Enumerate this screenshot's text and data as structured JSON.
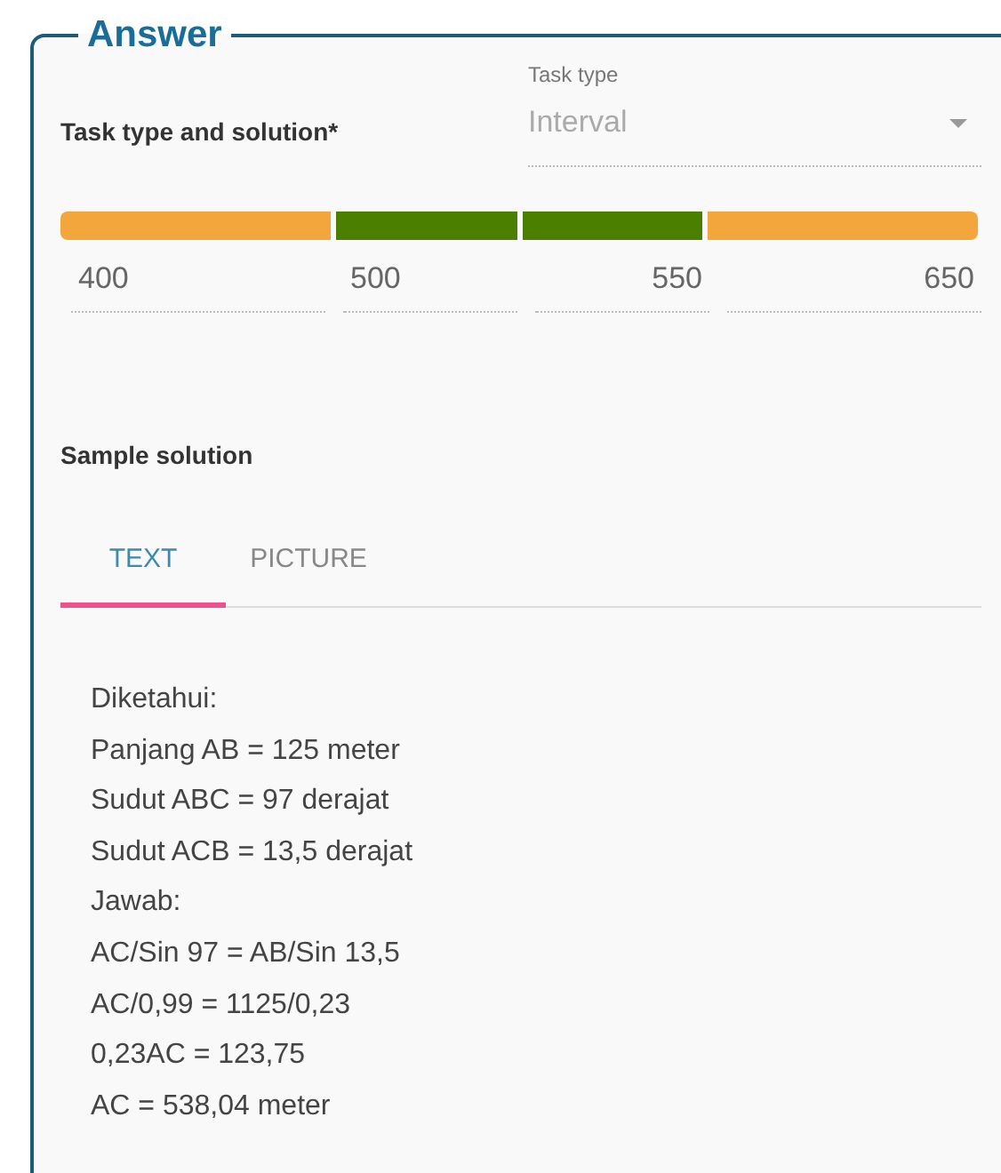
{
  "legend": "Answer",
  "task_row": {
    "label": "Task type and solution*",
    "select": {
      "label": "Task type",
      "value": "Interval",
      "disabled": true
    }
  },
  "interval": {
    "segments": [
      {
        "color": "#f2a63b"
      },
      {
        "color": "#4a7f00"
      },
      {
        "color": "#4a7f00"
      },
      {
        "color": "#f2a63b"
      }
    ],
    "fields": [
      {
        "value": "400"
      },
      {
        "value": "500"
      },
      {
        "value": "550"
      },
      {
        "value": "650"
      }
    ]
  },
  "sample": {
    "title": "Sample solution",
    "tabs": [
      {
        "label": "TEXT",
        "selected": true
      },
      {
        "label": "PICTURE",
        "selected": false
      }
    ],
    "lines": [
      "Diketahui:",
      "Panjang AB = 125 meter",
      "Sudut ABC = 97 derajat",
      "Sudut ACB = 13,5 derajat",
      "Jawab:",
      "AC/Sin 97 = AB/Sin 13,5",
      "AC/0,99 = 1125/0,23",
      "0,23AC = 123,75",
      "AC = 538,04 meter"
    ]
  }
}
